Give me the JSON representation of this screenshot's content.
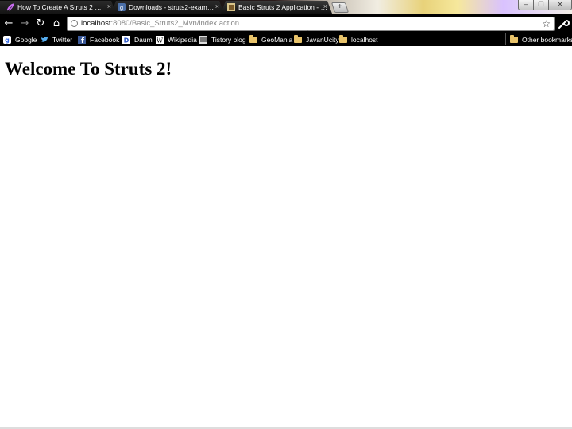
{
  "tabs": [
    {
      "title": "How To Create A Struts 2 …",
      "active": false
    },
    {
      "title": "Downloads - struts2-exam…",
      "active": false
    },
    {
      "title": "Basic Struts 2 Application - …",
      "active": true
    }
  ],
  "tab_close_glyph": "×",
  "new_tab_glyph": "+",
  "window_controls": {
    "minimize": "–",
    "maximize": "❐",
    "close": "✕"
  },
  "toolbar": {
    "back_icon": "←",
    "forward_icon": "→",
    "reload_icon": "↻",
    "home_icon": "⌂",
    "url_host": "localhost",
    "url_rest": ":8080/Basic_Struts2_Mvn/index.action",
    "star_icon": "☆",
    "wrench_icon": "🔧"
  },
  "bookmarks": [
    {
      "label": "Google",
      "icon": "google-icon"
    },
    {
      "label": "Twitter",
      "icon": "twitter-icon"
    },
    {
      "label": "Facebook",
      "icon": "facebook-icon"
    },
    {
      "label": "Daum",
      "icon": "daum-icon"
    },
    {
      "label": "Wikipedia",
      "icon": "wikipedia-icon"
    },
    {
      "label": "Tistory blog",
      "icon": "tistory-icon"
    },
    {
      "label": "GeoMania",
      "icon": "folder-icon"
    },
    {
      "label": "JavanUcity",
      "icon": "folder-icon"
    },
    {
      "label": "localhost",
      "icon": "folder-icon"
    }
  ],
  "other_bookmarks": "Other bookmarks",
  "page": {
    "heading": "Welcome To Struts 2!"
  },
  "colors": {
    "chrome_bg": "#000000",
    "page_bg": "#ffffff",
    "folder": "#e8c36a"
  }
}
